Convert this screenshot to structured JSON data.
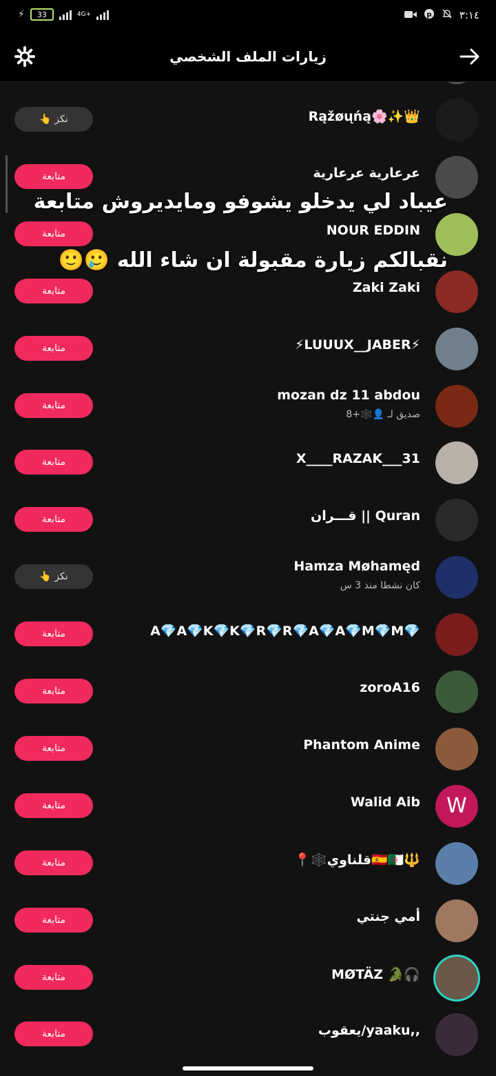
{
  "status_bar": {
    "battery": "33",
    "network": "4G+",
    "time": "٣:١٤",
    "icons": [
      "bolt-icon",
      "battery-icon",
      "signal-icon",
      "signal-icon",
      "video-icon",
      "pinterest-icon",
      "mute-bell-icon"
    ]
  },
  "header": {
    "title": "زيارات الملف الشخصي",
    "left_icon": "gear-icon",
    "right_icon": "arrow-right-icon"
  },
  "overlay_text": {
    "line1": "عيباد لي يدخلو يشوفو ومايديروش متابعة",
    "line2": "نقبالكم زيارة مقبولة ان شاء الله 🥲🙂"
  },
  "buttons": {
    "follow": "متابعة",
    "poke": "👆 نكز"
  },
  "visitors": [
    {
      "name": "Rąžøųńą🌸✨👑",
      "subtitle": "",
      "action": "poke",
      "avatar_color": "#1b1b1b",
      "avatar_letter": ""
    },
    {
      "name": "عرعارية عرعارية",
      "subtitle": "",
      "action": "follow",
      "avatar_color": "#4a4a4a",
      "avatar_letter": ""
    },
    {
      "name": "NOUR EDDIN",
      "subtitle": "",
      "action": "follow",
      "avatar_color": "#9fbf5a",
      "avatar_letter": ""
    },
    {
      "name": "Zaki Zaki",
      "subtitle": "",
      "action": "follow",
      "avatar_color": "#8a2a22",
      "avatar_letter": ""
    },
    {
      "name": "⚡LUUUX__JABER⚡",
      "subtitle": "",
      "action": "follow",
      "avatar_color": "#6f7f8c",
      "avatar_letter": ""
    },
    {
      "name": "mozan dz 11 abdou",
      "subtitle": "صديق لـ 👤🕸️+8",
      "action": "follow",
      "avatar_color": "#7a2a14",
      "avatar_letter": ""
    },
    {
      "name": "X____RAZAK___31",
      "subtitle": "",
      "action": "follow",
      "avatar_color": "#b9b0a8",
      "avatar_letter": ""
    },
    {
      "name": "قـــران || Quran",
      "subtitle": "",
      "action": "follow",
      "avatar_color": "#2a2a2a",
      "avatar_letter": ""
    },
    {
      "name": "Hamza Møhamęd",
      "subtitle": "كان نشطا منذ 3 س",
      "action": "poke",
      "avatar_color": "#1f2f6a",
      "avatar_letter": ""
    },
    {
      "name": "A💎A💎K💎K💎R💎R💎A💎A💎M💎M💎",
      "subtitle": "",
      "action": "follow",
      "avatar_color": "#7a1d1d",
      "avatar_letter": ""
    },
    {
      "name": "zoroA16",
      "subtitle": "",
      "action": "follow",
      "avatar_color": "#3b5a3a",
      "avatar_letter": ""
    },
    {
      "name": "Phantom Anime",
      "subtitle": "",
      "action": "follow",
      "avatar_color": "#8a5a3a",
      "avatar_letter": ""
    },
    {
      "name": "Walid Aib",
      "subtitle": "",
      "action": "follow",
      "avatar_color": "#c2185b",
      "avatar_letter": "W"
    },
    {
      "name": "📍🕸️قلناوي🇪🇸🇩🇿🔱",
      "subtitle": "",
      "action": "follow",
      "avatar_color": "#5a7fa8",
      "avatar_letter": ""
    },
    {
      "name": "أمي جنتي",
      "subtitle": "",
      "action": "follow",
      "avatar_color": "#a07860",
      "avatar_letter": ""
    },
    {
      "name": "MØTÄZ 🐊🎧",
      "subtitle": "",
      "action": "follow",
      "avatar_color": "#6a5848",
      "avatar_letter": "",
      "ring": true
    },
    {
      "name": "يعقوب/yaaku,,",
      "subtitle": "",
      "action": "follow",
      "avatar_color": "#3a2a3a",
      "avatar_letter": ""
    }
  ]
}
